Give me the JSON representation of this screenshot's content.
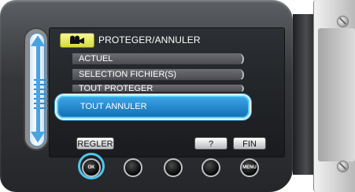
{
  "title": "PROTEGER/ANNULER",
  "menu": {
    "items": [
      {
        "label": "ACTUEL"
      },
      {
        "label": "SELECTION FICHIER(S)"
      },
      {
        "label": "TOUT PROTEGER"
      },
      {
        "label": "TOUT ANNULER",
        "selected": true
      }
    ]
  },
  "softkeys": {
    "regler": "REGLER",
    "help": "?",
    "fin": "FIN"
  },
  "buttons": {
    "ok": "OK",
    "menu": "MENU"
  },
  "icons": {
    "mode": "movie-camera-icon",
    "scroll": "up-down-arrows-icon"
  },
  "colors": {
    "selection": "#2a8fd6",
    "highlight_ring": "#4fc6ef",
    "mode_badge": "#e5e85a"
  }
}
